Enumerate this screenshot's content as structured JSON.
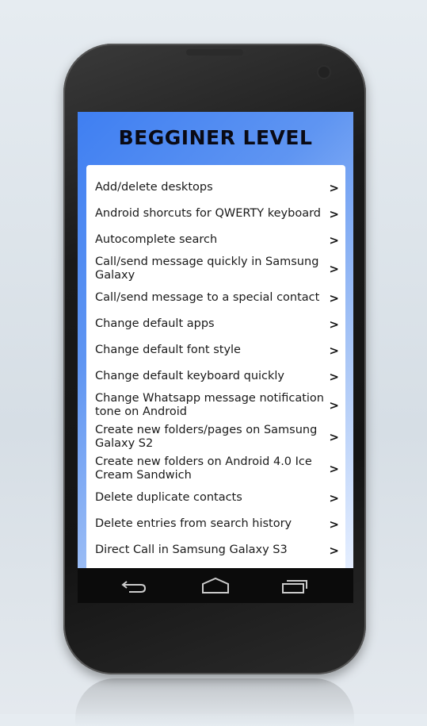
{
  "header": {
    "title": "BEGGINER LEVEL"
  },
  "list": {
    "items": [
      {
        "label": "Add/delete desktops",
        "lines": 1
      },
      {
        "label": "Android shorcuts for QWERTY keyboard",
        "lines": 1
      },
      {
        "label": "Autocomplete search",
        "lines": 1
      },
      {
        "label": "Call/send message quickly in Samsung Galaxy",
        "lines": 2
      },
      {
        "label": "Call/send message to a special contact",
        "lines": 1
      },
      {
        "label": "Change default apps",
        "lines": 1
      },
      {
        "label": "Change default font style",
        "lines": 1
      },
      {
        "label": "Change default keyboard quickly",
        "lines": 1
      },
      {
        "label": "Change Whatsapp message notification tone on Android",
        "lines": 2
      },
      {
        "label": "Create new folders/pages on Samsung Galaxy S2",
        "lines": 2
      },
      {
        "label": "Create new folders on Android 4.0 Ice Cream Sandwich",
        "lines": 2
      },
      {
        "label": "Delete duplicate contacts",
        "lines": 1
      },
      {
        "label": "Delete entries from search history",
        "lines": 1
      },
      {
        "label": "Direct Call in Samsung Galaxy S3",
        "lines": 1
      }
    ],
    "chevron": ">"
  },
  "nav": {
    "icons": [
      "back-icon",
      "home-icon",
      "recent-apps-icon"
    ]
  },
  "colors": {
    "gradient_start": "#3f7ff2",
    "gradient_end": "#e6efff",
    "nav_bar": "#0b0b0b"
  }
}
